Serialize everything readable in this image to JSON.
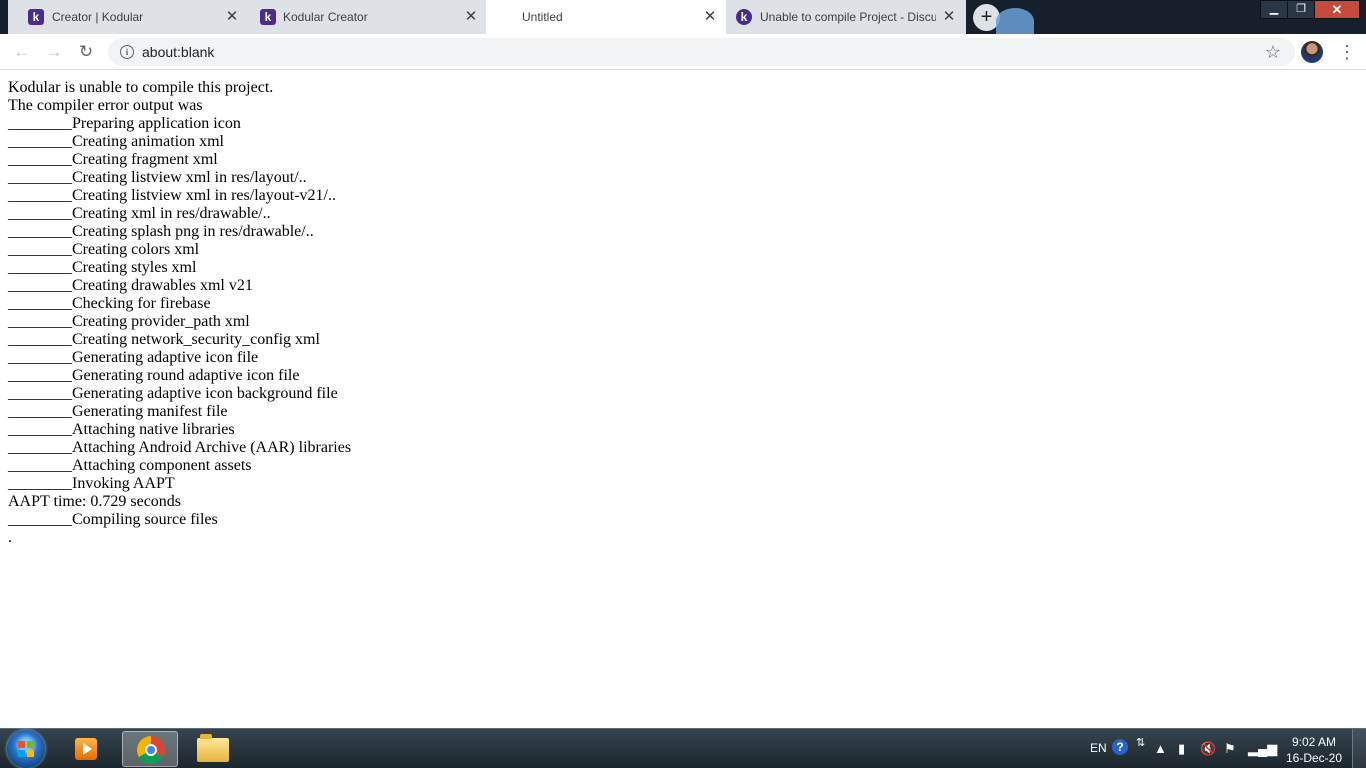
{
  "browser": {
    "tabs": [
      {
        "title": "Creator | Kodular",
        "favicon": "kodular-icon",
        "active": false
      },
      {
        "title": "Kodular Creator",
        "favicon": "kodular-icon",
        "active": false
      },
      {
        "title": "Untitled",
        "favicon": "",
        "active": true
      },
      {
        "title": "Unable to compile Project - Discu",
        "favicon": "kodular-discuss-icon",
        "active": false
      }
    ],
    "address": "about:blank",
    "colors": {
      "tabstrip": "#16202c",
      "inactive_tab": "#dee1e6",
      "kodular_purple": "#4a2b8f"
    }
  },
  "page": {
    "lines": [
      "Kodular is unable to compile this project.",
      "The compiler error output was",
      "________Preparing application icon",
      "________Creating animation xml",
      "________Creating fragment xml",
      "________Creating listview xml in res/layout/..",
      "________Creating listview xml in res/layout-v21/..",
      "________Creating xml in res/drawable/..",
      "________Creating splash png in res/drawable/..",
      "________Creating colors xml",
      "________Creating styles xml",
      "________Creating drawables xml v21",
      "________Checking for firebase",
      "________Creating provider_path xml",
      "________Creating network_security_config xml",
      "________Generating adaptive icon file",
      "________Generating round adaptive icon file",
      "________Generating adaptive icon background file",
      "________Generating manifest file",
      "________Attaching native libraries",
      "________Attaching Android Archive (AAR) libraries",
      "________Attaching component assets",
      "________Invoking AAPT",
      "AAPT time: 0.729 seconds",
      "________Compiling source files",
      "."
    ]
  },
  "taskbar": {
    "language": "EN",
    "help": "?",
    "time": "9:02 AM",
    "date": "16-Dec-20"
  }
}
